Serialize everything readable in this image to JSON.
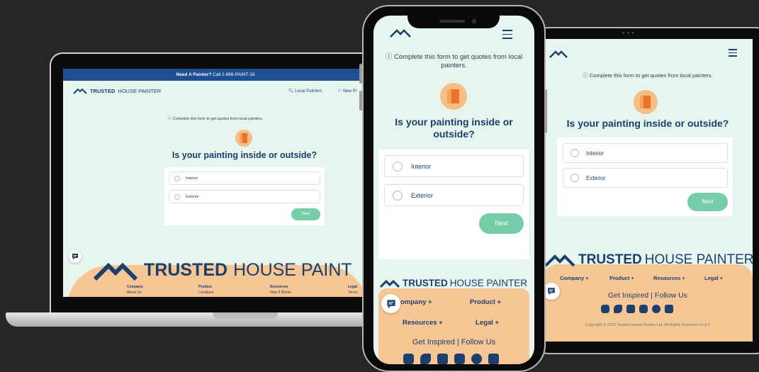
{
  "colors": {
    "navy": "#1d3f6e",
    "mint_bg": "#e7f5ef",
    "next_green": "#76cea9",
    "footer_peach": "#f6c695",
    "door_orange": "#f6be82",
    "topbar_blue": "#1d4f91"
  },
  "desktop": {
    "topbar": {
      "prefix": "Need A Painter?",
      "suffix": " Call 1-866-PAINT-18"
    },
    "logo": {
      "bold": "TRUSTED",
      "light": "HOUSE PAINTER"
    },
    "nav": {
      "local_painters": "Local Painters",
      "new_pro": "New Pr"
    },
    "info": "Complete this form to get quotes from local painters.",
    "question": "Is your painting inside or outside?",
    "options": [
      "Interior",
      "Exterior"
    ],
    "next_label": "Next",
    "footer_brand": {
      "bold": "TRUSTED",
      "light": "HOUSE PAINT"
    },
    "footer_cols": [
      {
        "heading": "Company",
        "link": "About Us"
      },
      {
        "heading": "Product",
        "link": "Locations"
      },
      {
        "heading": "Resources",
        "link": "How It Works"
      },
      {
        "heading": "Legal",
        "link": "Terms"
      }
    ]
  },
  "phone": {
    "info": "Complete this form to get quotes from local painters.",
    "question": "Is your painting inside or outside?",
    "options": [
      "Interior",
      "Exterior"
    ],
    "next_label": "Next",
    "footer_brand": {
      "bold": "TRUSTED",
      "light": "HOUSE PAINTER"
    },
    "footer_menu": [
      "ompany +",
      "Product +",
      "Resources +",
      "Legal +"
    ],
    "follow": "Get Inspired | Follow Us",
    "social_icons": [
      "instagram-icon",
      "twitter-icon",
      "facebook-icon",
      "youtube-icon",
      "pinterest-icon",
      "linkedin-icon"
    ]
  },
  "tablet": {
    "info": "Complete this form to get quotes from local painters.",
    "question": "Is your painting inside or outside?",
    "options": [
      "Interior",
      "Exterior"
    ],
    "next_label": "Next",
    "footer_brand": {
      "bold": "TRUSTED",
      "light": "HOUSE PAINTER"
    },
    "footer_menu": [
      "Company +",
      "Product +",
      "Resources +",
      "Legal +"
    ],
    "follow": "Get Inspired | Follow Us",
    "social_icons": [
      "instagram-icon",
      "twitter-icon",
      "facebook-icon",
      "youtube-icon",
      "pinterest-icon",
      "linkedin-icon"
    ],
    "copyright": "Copyright © 2022 Trusted House Painter Ltd. All Rights Reserved v1.9.0"
  }
}
